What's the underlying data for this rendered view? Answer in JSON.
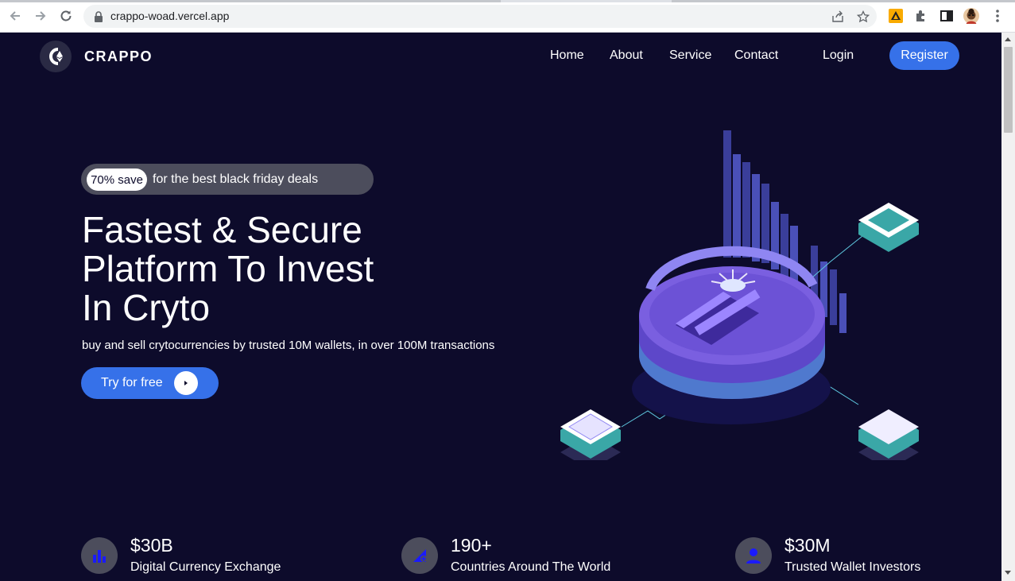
{
  "browser": {
    "url": "crappo-woad.vercel.app"
  },
  "nav": {
    "brand": "CRAPPO",
    "links": [
      "Home",
      "About",
      "Service",
      "Contact"
    ],
    "login": "Login",
    "register": "Register"
  },
  "hero": {
    "badge": "70% save",
    "promo_text": "for the best black friday deals",
    "title_lines": [
      "Fastest & Secure",
      "Platform To Invest",
      "In Cryto"
    ],
    "subtitle": "buy and sell crytocurrencies by trusted 10M wallets, in over 100M transactions",
    "cta": "Try for free"
  },
  "stats": [
    {
      "value": "$30B",
      "label": "Digital Currency Exchange",
      "icon": "bar-chart-icon"
    },
    {
      "value": "190+",
      "label": "Countries Around The World",
      "icon": "globe-icon"
    },
    {
      "value": "$30M",
      "label": "Trusted Wallet Investors",
      "icon": "user-icon"
    }
  ],
  "colors": {
    "background": "#0d0b2b",
    "accent": "#3671e9",
    "pill": "#4c4d5c",
    "stat_icon": "#1a1aff"
  }
}
